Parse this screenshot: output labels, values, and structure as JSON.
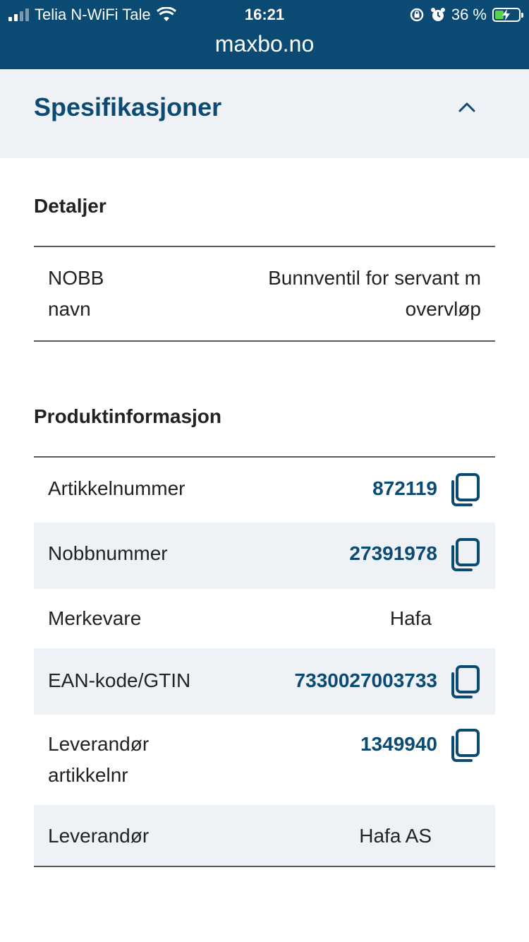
{
  "status_bar": {
    "carrier": "Telia N-WiFi Tale",
    "time": "16:21",
    "battery_percent": "36 %",
    "battery_level": 0.36,
    "icons": [
      "signal-icon",
      "wifi-icon",
      "rotation-lock-icon",
      "alarm-icon",
      "battery-charging-icon"
    ]
  },
  "browser": {
    "url": "maxbo.no"
  },
  "spec": {
    "title": "Spesifikasjoner",
    "toggle_icon": "chevron-up-icon"
  },
  "details": {
    "heading": "Detaljer",
    "rows": [
      {
        "key": "NOBB navn",
        "value": "Bunnventil for servant m overvløp"
      }
    ]
  },
  "product_info": {
    "heading": "Produktinformasjon",
    "rows": [
      {
        "key": "Artikkelnummer",
        "value": "872119",
        "copyable": true
      },
      {
        "key": "Nobbnummer",
        "value": "27391978",
        "copyable": true
      },
      {
        "key": "Merkevare",
        "value": "Hafa",
        "copyable": false
      },
      {
        "key": "EAN-kode/GTIN",
        "value": "7330027003733",
        "copyable": true
      },
      {
        "key": "Leverandør artikkelnr",
        "value": "1349940",
        "copyable": true
      },
      {
        "key": "Leverandør",
        "value": "Hafa AS",
        "copyable": false
      }
    ]
  },
  "colors": {
    "brand": "#0b4a72",
    "section_bg": "#eef1f5",
    "text": "#222222",
    "battery_green": "#5ad14a"
  }
}
